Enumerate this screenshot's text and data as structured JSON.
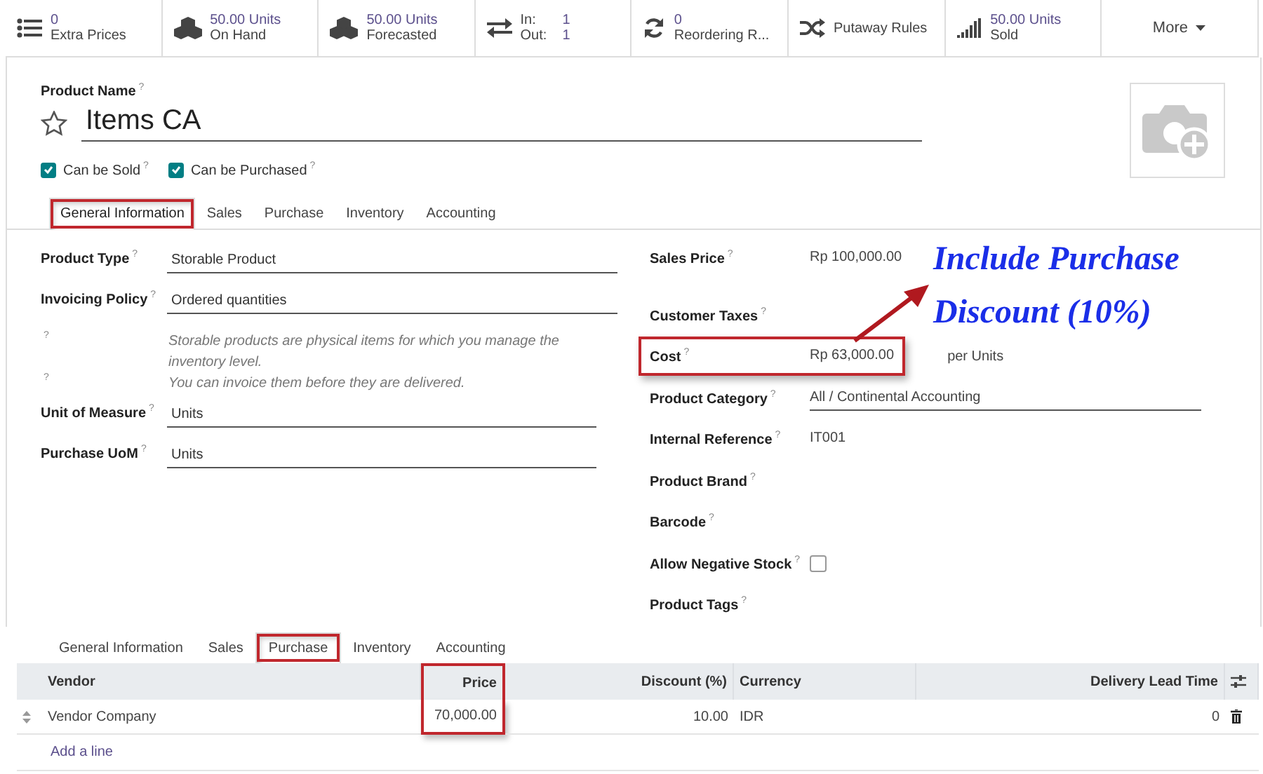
{
  "stat_buttons": [
    {
      "kind": "stat",
      "value": "0",
      "label": "Extra Prices"
    },
    {
      "kind": "stat",
      "value": "50.00 Units",
      "label": "On Hand"
    },
    {
      "kind": "stat",
      "value": "50.00 Units",
      "label": "Forecasted"
    },
    {
      "kind": "inout",
      "rows": [
        {
          "label": "In:",
          "value": "1"
        },
        {
          "label": "Out:",
          "value": "1"
        }
      ]
    },
    {
      "kind": "stat",
      "value": "0",
      "label": "Reordering R..."
    },
    {
      "kind": "text",
      "label": "Putaway Rules"
    },
    {
      "kind": "stat",
      "value": "50.00 Units",
      "label": "Sold"
    },
    {
      "kind": "more",
      "label": "More"
    }
  ],
  "product": {
    "name_label": "Product Name",
    "name_help": "?",
    "name": "Items CA",
    "favorite": false,
    "checkboxes": [
      {
        "label": "Can be Sold",
        "help": "?",
        "checked": true
      },
      {
        "label": "Can be Purchased",
        "help": "?",
        "checked": true
      }
    ]
  },
  "tabs": [
    {
      "label": "General Information",
      "selected": true,
      "highlighted": true
    },
    {
      "label": "Sales",
      "selected": false,
      "highlighted": false
    },
    {
      "label": "Purchase",
      "selected": false,
      "highlighted": false
    },
    {
      "label": "Inventory",
      "selected": false,
      "highlighted": false
    },
    {
      "label": "Accounting",
      "selected": false,
      "highlighted": false
    }
  ],
  "left_fields": [
    {
      "kind": "field",
      "label": "Product Type",
      "help": "?",
      "value": "Storable Product"
    },
    {
      "kind": "field",
      "label": "Invoicing Policy",
      "help": "?",
      "value": "Ordered quantities"
    },
    {
      "kind": "note",
      "help": "?",
      "text": "Storable products are physical items for which you manage the inventory level."
    },
    {
      "kind": "note",
      "help": "?",
      "text": "You can invoice them before they are delivered."
    },
    {
      "kind": "field",
      "label": "Unit of Measure",
      "help": "?",
      "value": "Units"
    },
    {
      "kind": "field",
      "label": "Purchase UoM",
      "help": "?",
      "value": "Units"
    }
  ],
  "right_fields": [
    {
      "kind": "readonly",
      "label": "Sales Price",
      "help": "?",
      "value": "Rp 100,000.00"
    },
    {
      "kind": "empty",
      "label": "Customer Taxes",
      "help": "?"
    },
    {
      "kind": "readonly",
      "label": "Cost",
      "help": "?",
      "value": "Rp 63,000.00",
      "suffix": "per Units",
      "highlighted": true
    },
    {
      "kind": "field",
      "label": "Product Category",
      "help": "?",
      "value": "All / Continental Accounting"
    },
    {
      "kind": "readonly",
      "label": "Internal Reference",
      "help": "?",
      "value": "IT001"
    },
    {
      "kind": "empty",
      "label": "Product Brand",
      "help": "?"
    },
    {
      "kind": "empty",
      "label": "Barcode",
      "help": "?"
    },
    {
      "kind": "checkbox",
      "label": "Allow Negative Stock",
      "help": "?",
      "checked": false
    },
    {
      "kind": "empty",
      "label": "Product Tags",
      "help": "?"
    }
  ],
  "callout": {
    "text": "Include Purchase Discount (10%)"
  },
  "purchase_tabs": [
    {
      "label": "General Information",
      "selected": false,
      "highlighted": false
    },
    {
      "label": "Sales",
      "selected": false,
      "highlighted": false
    },
    {
      "label": "Purchase",
      "selected": true,
      "highlighted": true
    },
    {
      "label": "Inventory",
      "selected": false,
      "highlighted": false
    },
    {
      "label": "Accounting",
      "selected": false,
      "highlighted": false
    }
  ],
  "vendor_table": {
    "columns": [
      {
        "label": "Vendor",
        "highlighted": false
      },
      {
        "label": "Price",
        "highlighted": true
      },
      {
        "label": "Discount (%)",
        "highlighted": false
      },
      {
        "label": "Currency",
        "highlighted": false
      },
      {
        "label": "Delivery Lead Time",
        "highlighted": false
      }
    ],
    "rows": [
      {
        "cells": [
          "Vendor Company",
          "70,000.00",
          "10.00",
          "IDR",
          "0"
        ]
      }
    ],
    "add_line": "Add a line"
  }
}
